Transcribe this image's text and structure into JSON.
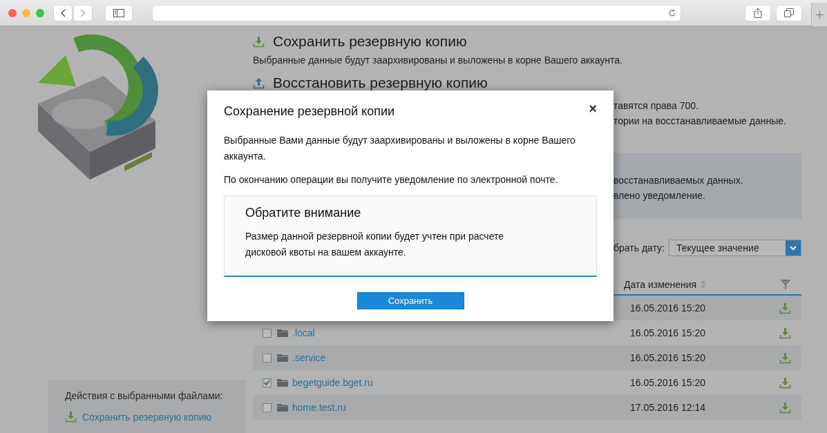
{
  "sections": [
    {
      "kind": "save",
      "title": "Сохранить резервную копию",
      "description": "Выбранные данные будут заархивированы и выложены в корне Вашего аккаунта."
    },
    {
      "kind": "restore",
      "title": "Восстановить резервную копию",
      "lines": [
        "тавятся права 700.",
        "тории на восстанавливаемые данные."
      ]
    }
  ],
  "info_box": {
    "lines": [
      "восстанавливаемых данных.",
      "влено уведомление."
    ]
  },
  "date_filter": {
    "label": "брать дату:",
    "value": "Текущее значение"
  },
  "table": {
    "columns": [
      {
        "label": "Дата изменения"
      }
    ],
    "rows": [
      {
        "date": "16.05.2016 15:20"
      },
      {
        "name": ".local",
        "checked": false,
        "date": "16.05.2016 15:20"
      },
      {
        "name": ".service",
        "checked": false,
        "date": "16.05.2016 15:20"
      },
      {
        "name": "begetguide.bget.ru",
        "checked": true,
        "date": "16.05.2016 15:20"
      },
      {
        "name": "home.test.ru",
        "checked": false,
        "date": "17.05.2016 12:14"
      }
    ]
  },
  "actions_panel": {
    "title": "Действия с выбранными файлами:",
    "items": [
      {
        "label": "Сохранить резервную копию"
      }
    ]
  },
  "dialog": {
    "title": "Сохранение резервной копии",
    "close": "×",
    "paragraphs": [
      "Выбранные Вами данные будут заархивированы и выложены в корне Вашего аккаунта.",
      "По окончанию операции вы получите уведомление по электронной почте."
    ],
    "notice": {
      "title": "Обратите внимание",
      "text": "Размер данной резервной копии будет учтен при расчете дисковой квоты на вашем аккаунте."
    },
    "button": "Сохранить"
  }
}
